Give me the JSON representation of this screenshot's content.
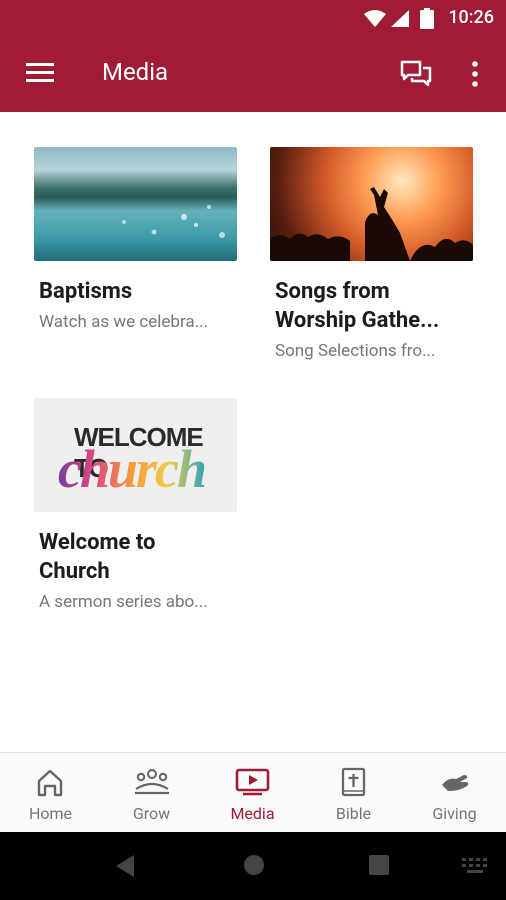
{
  "status_bar": {
    "time": "10:26"
  },
  "app_bar": {
    "title": "Media"
  },
  "media_items": [
    {
      "title": "Baptisms",
      "subtitle": "Watch as we celebra..."
    },
    {
      "title": "Songs from\nWorship Gathe...",
      "subtitle": "Song Selections fro..."
    },
    {
      "title": "Welcome to\nChurch",
      "subtitle": "A sermon series abo...",
      "thumb_text": {
        "line1": "WELCOME TO",
        "line2": "church"
      }
    }
  ],
  "bottom_nav": [
    {
      "label": "Home",
      "icon": "home-icon",
      "active": false
    },
    {
      "label": "Grow",
      "icon": "people-icon",
      "active": false
    },
    {
      "label": "Media",
      "icon": "tv-play-icon",
      "active": true
    },
    {
      "label": "Bible",
      "icon": "bible-icon",
      "active": false
    },
    {
      "label": "Giving",
      "icon": "giving-hand-icon",
      "active": false
    }
  ],
  "colors": {
    "brand": "#a01c36",
    "text_primary": "#1c1c1c",
    "text_secondary": "#767676"
  }
}
